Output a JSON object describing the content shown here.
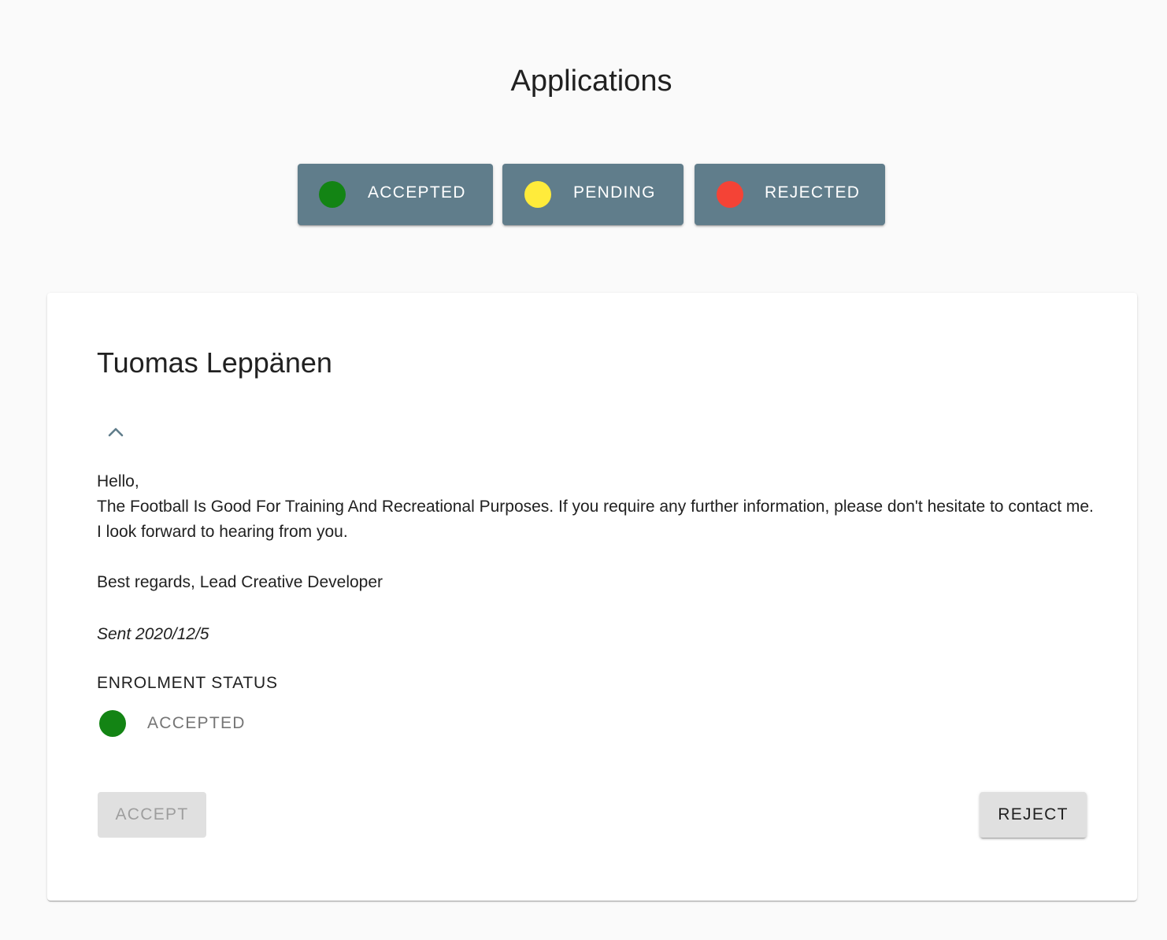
{
  "page": {
    "title": "Applications"
  },
  "filters": [
    {
      "label": "ACCEPTED",
      "color": "#138414"
    },
    {
      "label": "PENDING",
      "color": "#ffeb3b"
    },
    {
      "label": "REJECTED",
      "color": "#f44336"
    }
  ],
  "application": {
    "name": "Tuomas Leppänen",
    "toggle_icon": "chevron-up-icon",
    "message": {
      "greeting": "Hello,",
      "body": "The Football Is Good For Training And Recreational Purposes. If you require any further information, please don't hesitate to contact me. I look forward to hearing from you.",
      "signoff": "Best regards, Lead Creative Developer"
    },
    "sent": "Sent 2020/12/5",
    "status_heading": "ENROLMENT STATUS",
    "status": {
      "label": "ACCEPTED",
      "color": "#138414"
    },
    "actions": {
      "accept_label": "ACCEPT",
      "accept_disabled": true,
      "reject_label": "REJECT"
    }
  },
  "colors": {
    "primary": "#607d8b",
    "background": "#fafafa"
  }
}
